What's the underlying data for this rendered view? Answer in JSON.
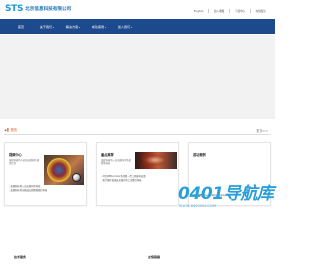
{
  "header": {
    "logo_mark": "STS",
    "logo_name": "北京信息科技有限公司",
    "links": [
      "English",
      "加入收藏",
      "下载中心",
      "在线留言"
    ]
  },
  "nav": {
    "items": [
      "首页",
      "关于我们",
      "解决方案",
      "成功案例",
      "加入我们"
    ]
  },
  "breadcrumb": {
    "icon": "bullet-icon",
    "home": "首页"
  },
  "more_label": "更多>>",
  "cards": [
    {
      "title": "视频中心",
      "text": "英视科技将人员和无缝同步通讯打造",
      "links": [
        "英视科技将入员无缝同步科技",
        "英视科技将无缝成无线智能图示科技"
      ]
    },
    {
      "title": "重点推荐",
      "text": "英视科技将入员无缝同步系统智慧科技",
      "links": [
        "2月份Elite Color系列第一代工商室内高清",
        "双手操作英视安全操作的工业整合科技"
      ]
    },
    {
      "title": "成功案例",
      "text": "",
      "links": [],
      "partner_label": "合作伙伴",
      "partner_label_en": "Cooperation partner"
    }
  ],
  "watermark": {
    "main": "0401导航库",
    "sub": "WWW.0401DH.COM"
  },
  "footer": {
    "left": "技术服务",
    "right": "友情链接"
  },
  "colors": {
    "nav_bg": "#1d4a8c",
    "logo": "#1a9ad6",
    "accent": "#e14b1a",
    "watermark": "#2ba0d8"
  }
}
